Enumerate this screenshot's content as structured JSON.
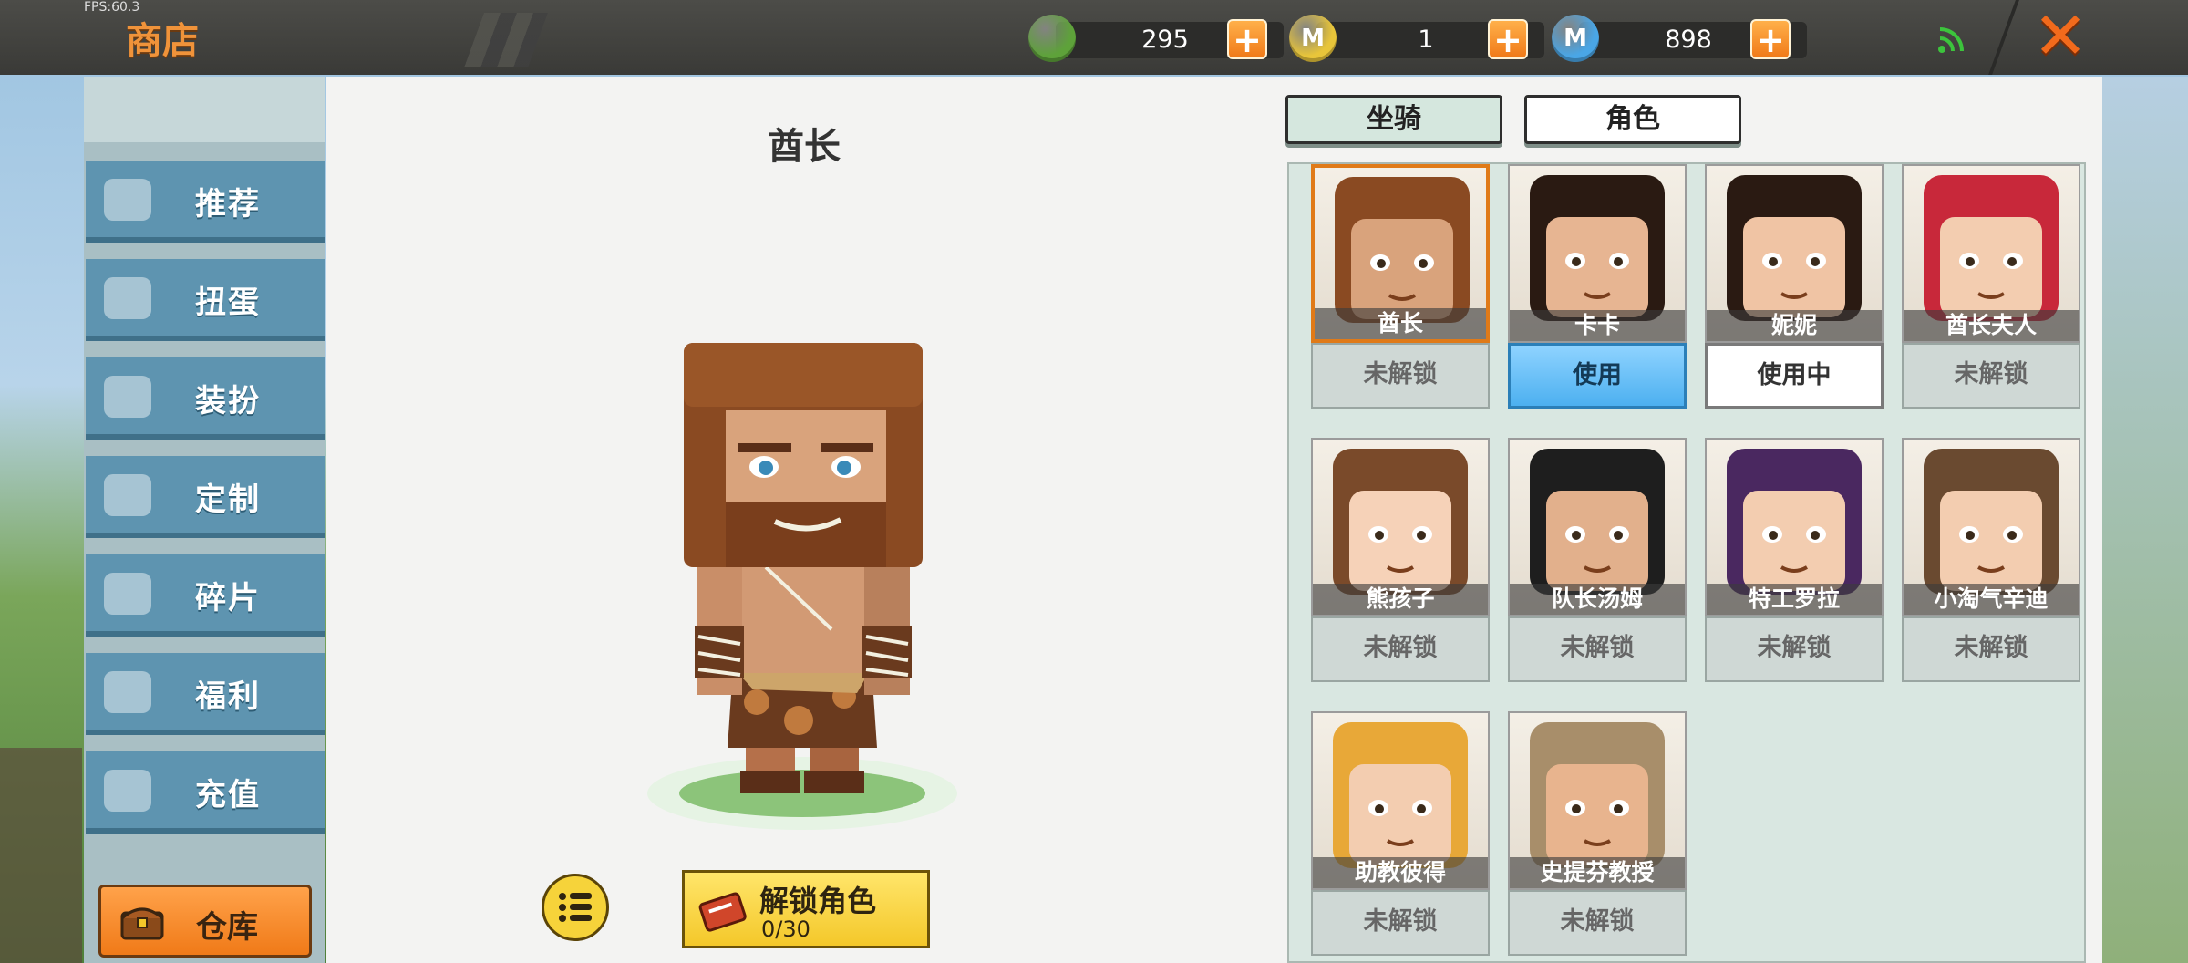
{
  "topbar": {
    "fps": "FPS:60.3",
    "title": "商店",
    "currencies": [
      {
        "icon": "green-gem-icon",
        "symbol": "",
        "amount": "295",
        "color": "#5ea23a"
      },
      {
        "icon": "gold-coin-icon",
        "symbol": "M",
        "amount": "1",
        "color": "#e8c53a"
      },
      {
        "icon": "blue-coin-icon",
        "symbol": "M",
        "amount": "898",
        "color": "#4aa6e6"
      }
    ],
    "plus_label": "+",
    "close_label": "✕"
  },
  "sidebar": {
    "items": [
      {
        "label": "推荐",
        "icon": "thumbs-up-icon"
      },
      {
        "label": "扭蛋",
        "icon": "capsule-icon"
      },
      {
        "label": "装扮",
        "icon": "shirt-icon"
      },
      {
        "label": "定制",
        "icon": "pencil-icon"
      },
      {
        "label": "碎片",
        "icon": "puzzle-icon"
      },
      {
        "label": "福利",
        "icon": "gift-icon"
      },
      {
        "label": "充值",
        "icon": "coins-icon"
      }
    ],
    "storage_label": "仓库"
  },
  "preview": {
    "character_name": "酋长",
    "unlock_label": "解锁角色",
    "unlock_count": "0/30"
  },
  "tabs": {
    "mount": "坐骑",
    "character": "角色"
  },
  "characters": [
    {
      "name": "酋长",
      "status": "未解锁",
      "state": "locked",
      "selected": true,
      "hair": "#8a4a22",
      "skin": "#d9a37c"
    },
    {
      "name": "卡卡",
      "status": "使用",
      "state": "use",
      "selected": false,
      "hair": "#2a1a12",
      "skin": "#e7b592"
    },
    {
      "name": "妮妮",
      "status": "使用中",
      "state": "inuse",
      "selected": false,
      "hair": "#2a1a12",
      "skin": "#f0c4a4"
    },
    {
      "name": "酋长夫人",
      "status": "未解锁",
      "state": "locked",
      "selected": false,
      "hair": "#c8283a",
      "skin": "#f3cdb0"
    },
    {
      "name": "熊孩子",
      "status": "未解锁",
      "state": "locked",
      "selected": false,
      "hair": "#7a4a2a",
      "skin": "#f6d2b8"
    },
    {
      "name": "队长汤姆",
      "status": "未解锁",
      "state": "locked",
      "selected": false,
      "hair": "#1e1e1e",
      "skin": "#e2b08c"
    },
    {
      "name": "特工罗拉",
      "status": "未解锁",
      "state": "locked",
      "selected": false,
      "hair": "#4a2860",
      "skin": "#f3cdb0"
    },
    {
      "name": "小淘气辛迪",
      "status": "未解锁",
      "state": "locked",
      "selected": false,
      "hair": "#6a4a30",
      "skin": "#f3cdb0"
    },
    {
      "name": "助教彼得",
      "status": "未解锁",
      "state": "locked",
      "selected": false,
      "hair": "#e8a838",
      "skin": "#f3cdb0"
    },
    {
      "name": "史提芬教授",
      "status": "未解锁",
      "state": "locked",
      "selected": false,
      "hair": "#a88e6a",
      "skin": "#e8b48e"
    }
  ]
}
